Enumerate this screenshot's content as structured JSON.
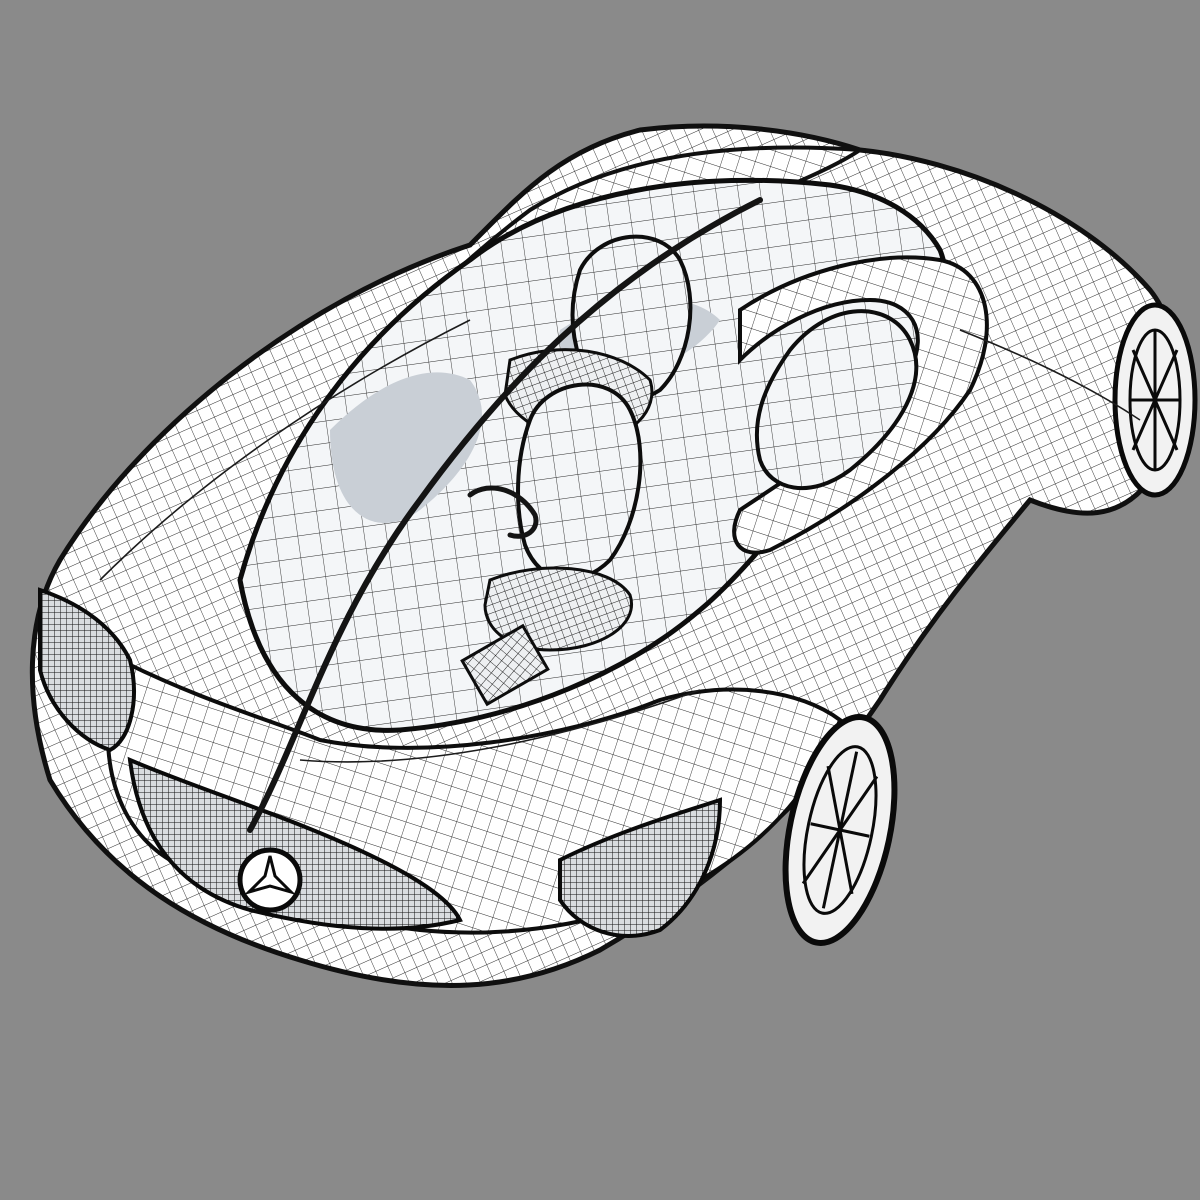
{
  "scene": {
    "background": "#8a8a8a",
    "surface": "#ffffff",
    "wire": "#222222",
    "shadow": "#c9cfd6"
  },
  "parts": [
    "car-body",
    "cockpit-opening",
    "driver-seat",
    "passenger-seat",
    "rear-seat",
    "front-grille",
    "left-intake",
    "right-intake",
    "star-emblem",
    "front-right-wheel",
    "rear-right-wheel",
    "central-spine",
    "roll-hoop"
  ]
}
